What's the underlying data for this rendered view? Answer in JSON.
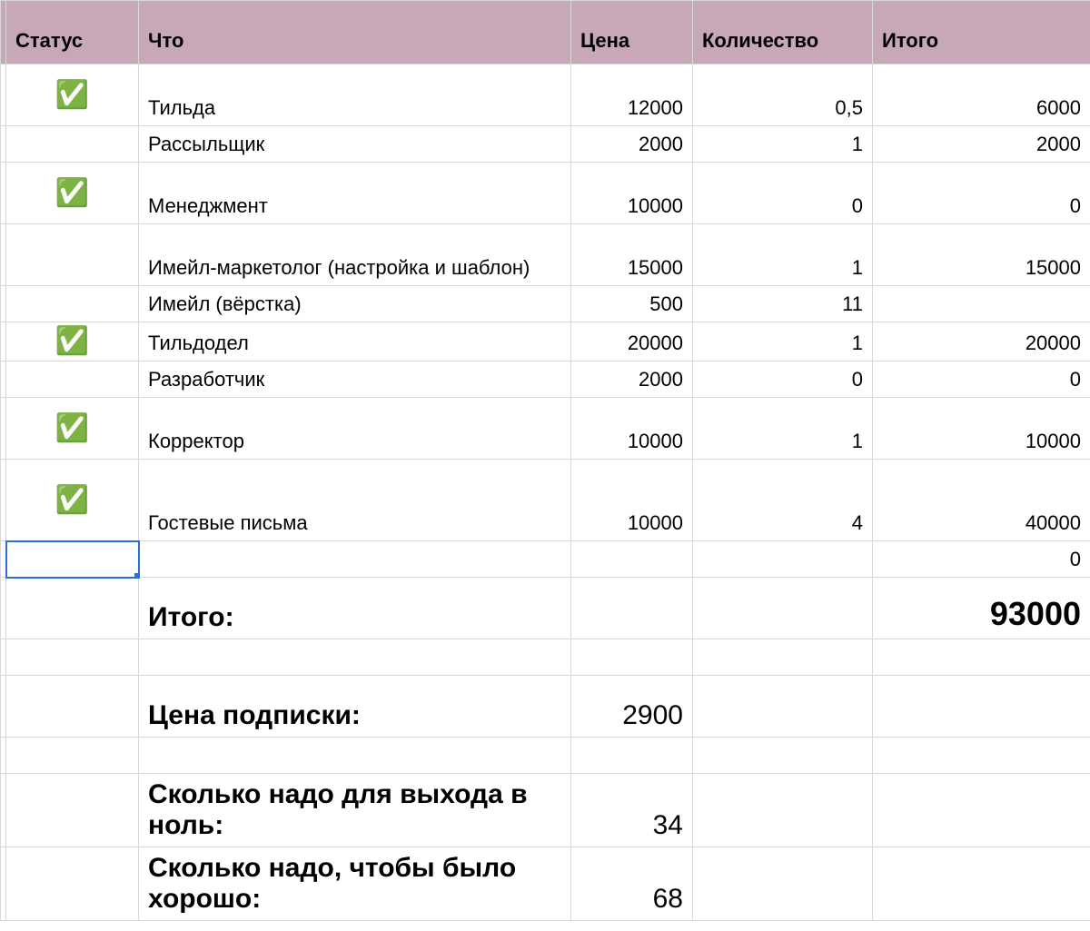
{
  "headers": {
    "status": "Статус",
    "what": "Что",
    "price": "Цена",
    "qty": "Количество",
    "total": "Итого"
  },
  "rows": [
    {
      "status": "✅",
      "what": "Тильда",
      "price": "12000",
      "qty": "0,5",
      "total": "6000",
      "tall": true
    },
    {
      "status": "",
      "what": "Рассыльщик",
      "price": "2000",
      "qty": "1",
      "total": "2000"
    },
    {
      "status": "✅",
      "what": "Менеджмент",
      "price": "10000",
      "qty": "0",
      "total": "0",
      "tall": true
    },
    {
      "status": "",
      "what": "Имейл-маркетолог (настройка и шаблон)",
      "price": "15000",
      "qty": "1",
      "total": "15000",
      "tall": true
    },
    {
      "status": "",
      "what": "Имейл (вёрстка)",
      "price": "500",
      "qty": "11",
      "total": ""
    },
    {
      "status": "✅",
      "what": "Тильдодел",
      "price": "20000",
      "qty": "1",
      "total": "20000"
    },
    {
      "status": "",
      "what": "Разработчик",
      "price": "2000",
      "qty": "0",
      "total": "0"
    },
    {
      "status": "✅",
      "what": "Корректор",
      "price": "10000",
      "qty": "1",
      "total": "10000",
      "tall": true
    },
    {
      "status": "✅",
      "what": "Гостевые письма",
      "price": "10000",
      "qty": "4",
      "total": "40000",
      "xtall": true
    }
  ],
  "zero_row_total": "0",
  "totals": {
    "label": "Итого:",
    "value": "93000"
  },
  "metrics": [
    {
      "label": "Цена подписки:",
      "value": "2900"
    },
    {
      "label": "Сколько надо для выхода в ноль:",
      "value": "34"
    },
    {
      "label": "Сколько надо, чтобы было хорошо:",
      "value": "68"
    }
  ]
}
